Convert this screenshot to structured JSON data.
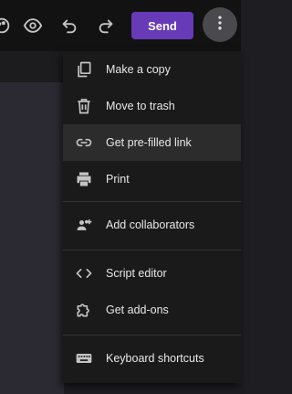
{
  "toolbar": {
    "send_label": "Send",
    "icons": [
      "palette-icon",
      "preview-eye-icon",
      "undo-icon",
      "redo-icon",
      "more-vert-icon"
    ]
  },
  "menu": {
    "items": [
      {
        "label": "Make a copy",
        "icon": "copy-icon"
      },
      {
        "label": "Move to trash",
        "icon": "trash-icon"
      },
      {
        "label": "Get pre-filled link",
        "icon": "link-icon"
      },
      {
        "label": "Print",
        "icon": "print-icon"
      },
      {
        "label": "Add collaborators",
        "icon": "add-collaborators-icon"
      },
      {
        "label": "Script editor",
        "icon": "code-icon"
      },
      {
        "label": "Get add-ons",
        "icon": "puzzle-icon"
      },
      {
        "label": "Keyboard shortcuts",
        "icon": "keyboard-icon"
      }
    ],
    "highlighted_item": "Get pre-filled link"
  },
  "colors": {
    "accent": "#673ab7",
    "menu_background": "#1a1a1a",
    "toolbar_background": "#121212",
    "icon_color": "#c4c4c4"
  }
}
